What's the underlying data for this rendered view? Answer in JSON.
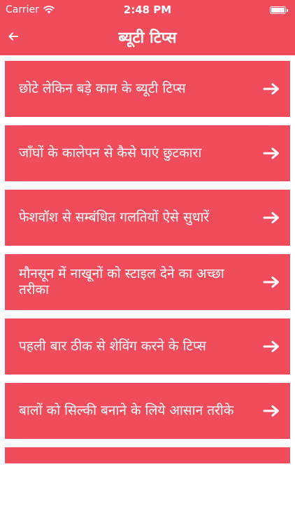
{
  "status_bar": {
    "carrier": "Carrier",
    "time": "2:48 PM",
    "wifi_icon": "wifi-icon",
    "battery_icon": "battery-icon"
  },
  "nav": {
    "title": "ब्यूटी टिप्स",
    "back_icon": "back-arrow-icon"
  },
  "colors": {
    "accent": "#f04c5c",
    "text": "#ffffff",
    "background": "#ffffff"
  },
  "items": [
    {
      "label": "छोटे लेकिन बड़े काम के ब्यूटी टिप्स",
      "icon": "arrow-right-icon"
    },
    {
      "label": "जाँघों के कालेपन से कैसे पाएं छुटकारा",
      "icon": "arrow-right-icon"
    },
    {
      "label": "फेशवॉश से सम्बंधित गलतियों ऐसे सुधारें",
      "icon": "arrow-right-icon"
    },
    {
      "label": "मौनसून में नाखूनों को स्टाइल देने का अच्छा तरीका",
      "icon": "arrow-right-icon"
    },
    {
      "label": "पहली बार ठीक से शेविंग करने के टिप्स",
      "icon": "arrow-right-icon"
    },
    {
      "label": "बालों को सिल्की बनाने के लिये आसान तरीके",
      "icon": "arrow-right-icon"
    },
    {
      "label": "",
      "icon": "arrow-right-icon"
    }
  ]
}
